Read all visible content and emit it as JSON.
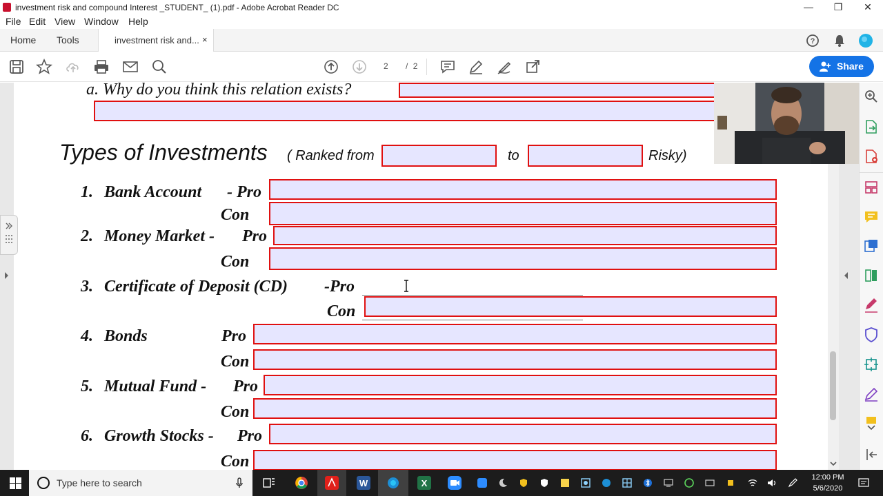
{
  "window": {
    "title": "investment risk and compound Interest _STUDENT_ (1).pdf - Adobe Acrobat Reader DC",
    "minimize": "—",
    "restore": "❐",
    "close": "✕"
  },
  "menu": [
    "File",
    "Edit",
    "View",
    "Window",
    "Help"
  ],
  "tabs": {
    "home": "Home",
    "tools": "Tools",
    "document": "investment risk and...",
    "close": "×"
  },
  "toolbar": {
    "current_page": "2",
    "page_sep": "/",
    "total_pages": "2",
    "share_label": "Share"
  },
  "document": {
    "question_a": "a.  Why do you think this relation exists?",
    "heading": "Types of Investments",
    "ranked_from": "( Ranked from",
    "to": "to",
    "risky": "Risky)",
    "items": [
      {
        "number": "1.",
        "name": "Bank Account",
        "pro": "- Pro",
        "con": "Con"
      },
      {
        "number": "2.",
        "name": "Money Market -",
        "pro": "Pro",
        "con": "Con"
      },
      {
        "number": "3.",
        "name": "Certificate of Deposit (CD)",
        "pro": "-Pro",
        "con": "Con"
      },
      {
        "number": "4.",
        "name": "Bonds",
        "pro": "Pro",
        "con": "Con"
      },
      {
        "number": "5.",
        "name": "Mutual Fund -",
        "pro": "Pro",
        "con": "Con"
      },
      {
        "number": "6.",
        "name": "Growth Stocks -",
        "pro": "Pro",
        "con": "Con"
      }
    ]
  },
  "taskbar": {
    "search_placeholder": "Type here to search",
    "time": "12:00 PM",
    "date": "5/6/2020"
  },
  "colors": {
    "field_border": "#e01010",
    "field_fill": "#e6e6ff",
    "share_blue": "#1473e6",
    "taskbar": "#1c1c1c"
  }
}
